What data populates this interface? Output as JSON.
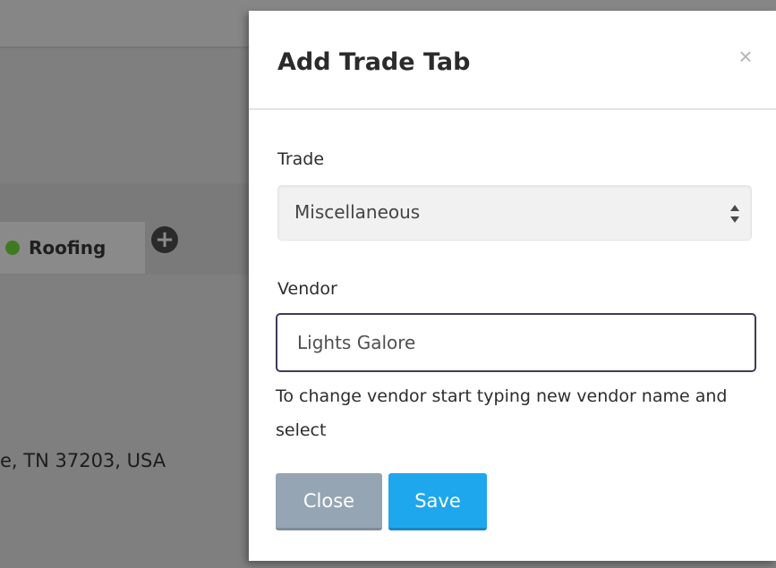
{
  "background": {
    "tab_label": "Roofing",
    "tab_status_color": "#3f7a20",
    "add_tab_icon": "plus-circle-icon",
    "address_fragment": "e, TN 37203, USA"
  },
  "modal": {
    "title": "Add Trade Tab",
    "close_glyph": "×",
    "trade": {
      "label": "Trade",
      "selected": "Miscellaneous",
      "icon": "select-arrows-icon"
    },
    "vendor": {
      "label": "Vendor",
      "value": "Lights Galore",
      "help": "To change vendor start typing new vendor name and select",
      "border_color": "#3f3a5c"
    },
    "buttons": {
      "close_label": "Close",
      "save_label": "Save",
      "close_color": "#95a5b3",
      "save_color": "#1ea7ed"
    }
  }
}
